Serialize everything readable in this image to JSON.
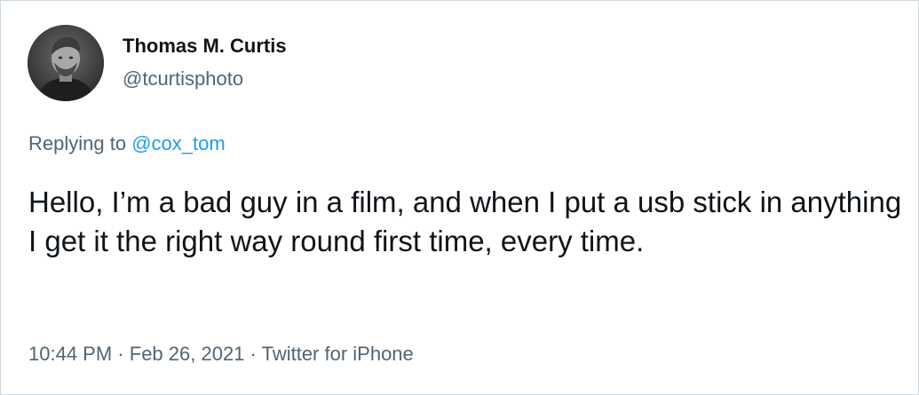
{
  "author": {
    "display_name": "Thomas M. Curtis",
    "handle": "@tcurtisphoto",
    "avatar_icon": "profile-photo"
  },
  "reply": {
    "prefix": "Replying to",
    "mention": "@cox_tom"
  },
  "tweet": {
    "text": "Hello, I’m a bad guy in a film, and when I put a usb stick in anything I get it the right way round first time, every time."
  },
  "meta": {
    "time": "10:44 PM",
    "separator": "·",
    "date": "Feb 26, 2021",
    "source": "Twitter for iPhone"
  },
  "colors": {
    "primary_text": "#0f1419",
    "secondary_text": "#536471",
    "link": "#1d9bf0",
    "border": "#cfd9de"
  }
}
